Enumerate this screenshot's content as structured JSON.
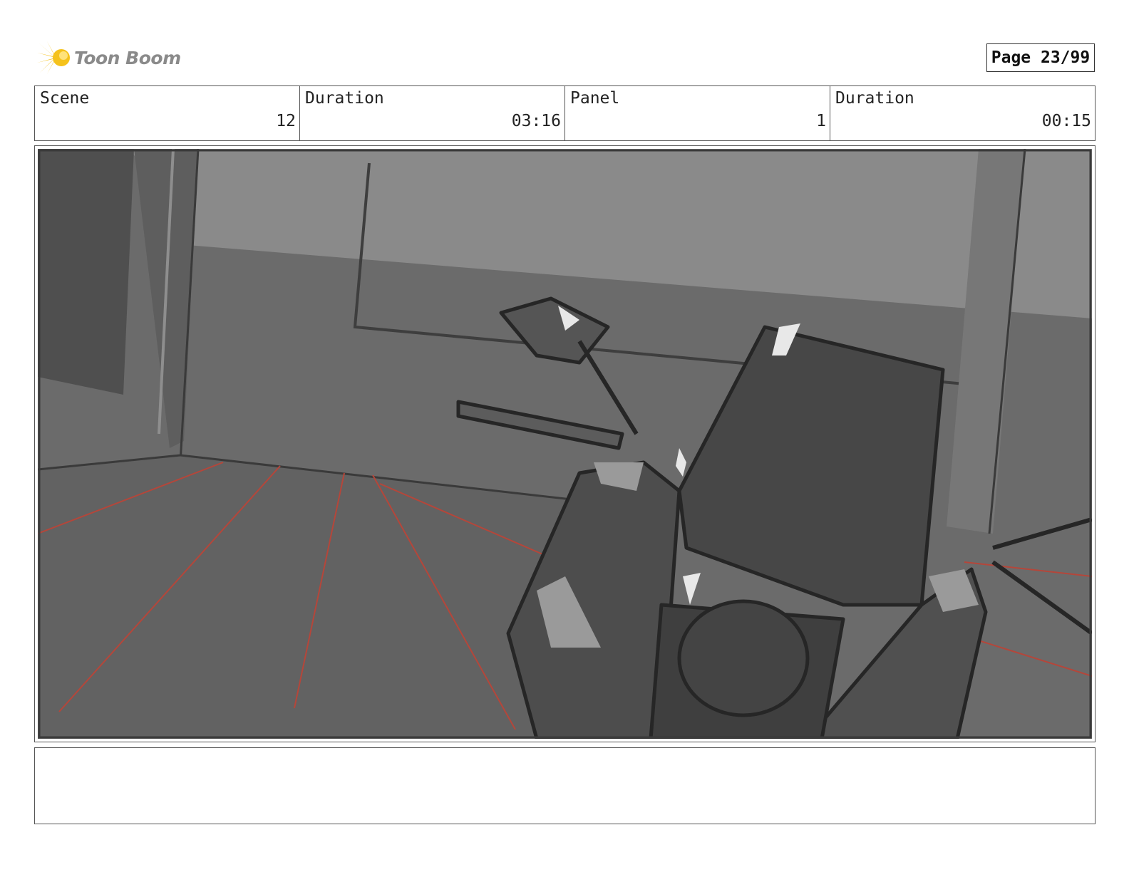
{
  "header": {
    "logo_text": "Toon Boom",
    "page_label": "Page 23/99"
  },
  "info": [
    {
      "label": "Scene",
      "value": "12"
    },
    {
      "label": "Duration",
      "value": "03:16"
    },
    {
      "label": "Panel",
      "value": "1"
    },
    {
      "label": "Duration",
      "value": "00:15"
    }
  ],
  "panel": {
    "description_icon": "storyboard-sketch-motorcycle-front"
  },
  "notes": {
    "text": ""
  },
  "colors": {
    "logo_yellow": "#f5c21b",
    "guide_red": "#b5463a",
    "sketch_gray": "#6a6a6a"
  }
}
